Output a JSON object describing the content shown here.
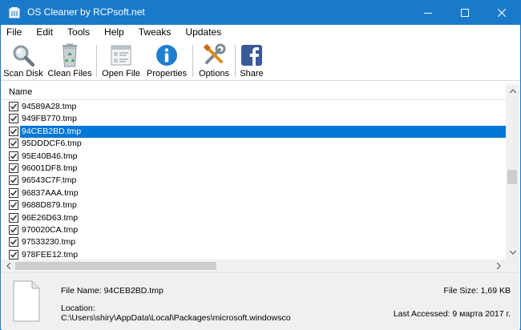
{
  "window": {
    "title": "OS Cleaner by RCPsoft.net",
    "accent": "#1979ca"
  },
  "menu": [
    "File",
    "Edit",
    "Tools",
    "Help",
    "Tweaks",
    "Updates"
  ],
  "toolbar": {
    "scan_disk": "Scan Disk",
    "clean_files": "Clean Files",
    "open_file": "Open File",
    "properties": "Properties",
    "options": "Options",
    "share": "Share"
  },
  "list": {
    "header": "Name",
    "rows": [
      {
        "name": "94589A28.tmp",
        "checked": true,
        "selected": false
      },
      {
        "name": "949FB770.tmp",
        "checked": true,
        "selected": false
      },
      {
        "name": "94CEB2BD.tmp",
        "checked": true,
        "selected": true
      },
      {
        "name": "95DDDCF6.tmp",
        "checked": true,
        "selected": false
      },
      {
        "name": "95E40B46.tmp",
        "checked": true,
        "selected": false
      },
      {
        "name": "96001DF8.tmp",
        "checked": true,
        "selected": false
      },
      {
        "name": "96543C7F.tmp",
        "checked": true,
        "selected": false
      },
      {
        "name": "96837AAA.tmp",
        "checked": true,
        "selected": false
      },
      {
        "name": "9688D879.tmp",
        "checked": true,
        "selected": false
      },
      {
        "name": "96E26D63.tmp",
        "checked": true,
        "selected": false
      },
      {
        "name": "970020CA.tmp",
        "checked": true,
        "selected": false
      },
      {
        "name": "97533230.tmp",
        "checked": true,
        "selected": false
      },
      {
        "name": "978FEE12.tmp",
        "checked": true,
        "selected": false
      }
    ],
    "selection_color": "#0078d7"
  },
  "info": {
    "file_name_label": "File Name: 94CEB2BD.tmp",
    "location_label": "Location:",
    "location_value": "C:\\Users\\shiry\\AppData\\Local\\Packages\\microsoft.windowsco",
    "file_size_label": "File Size: 1,69 KB",
    "last_accessed_label": "Last Accessed: 9 марта 2017 г."
  }
}
